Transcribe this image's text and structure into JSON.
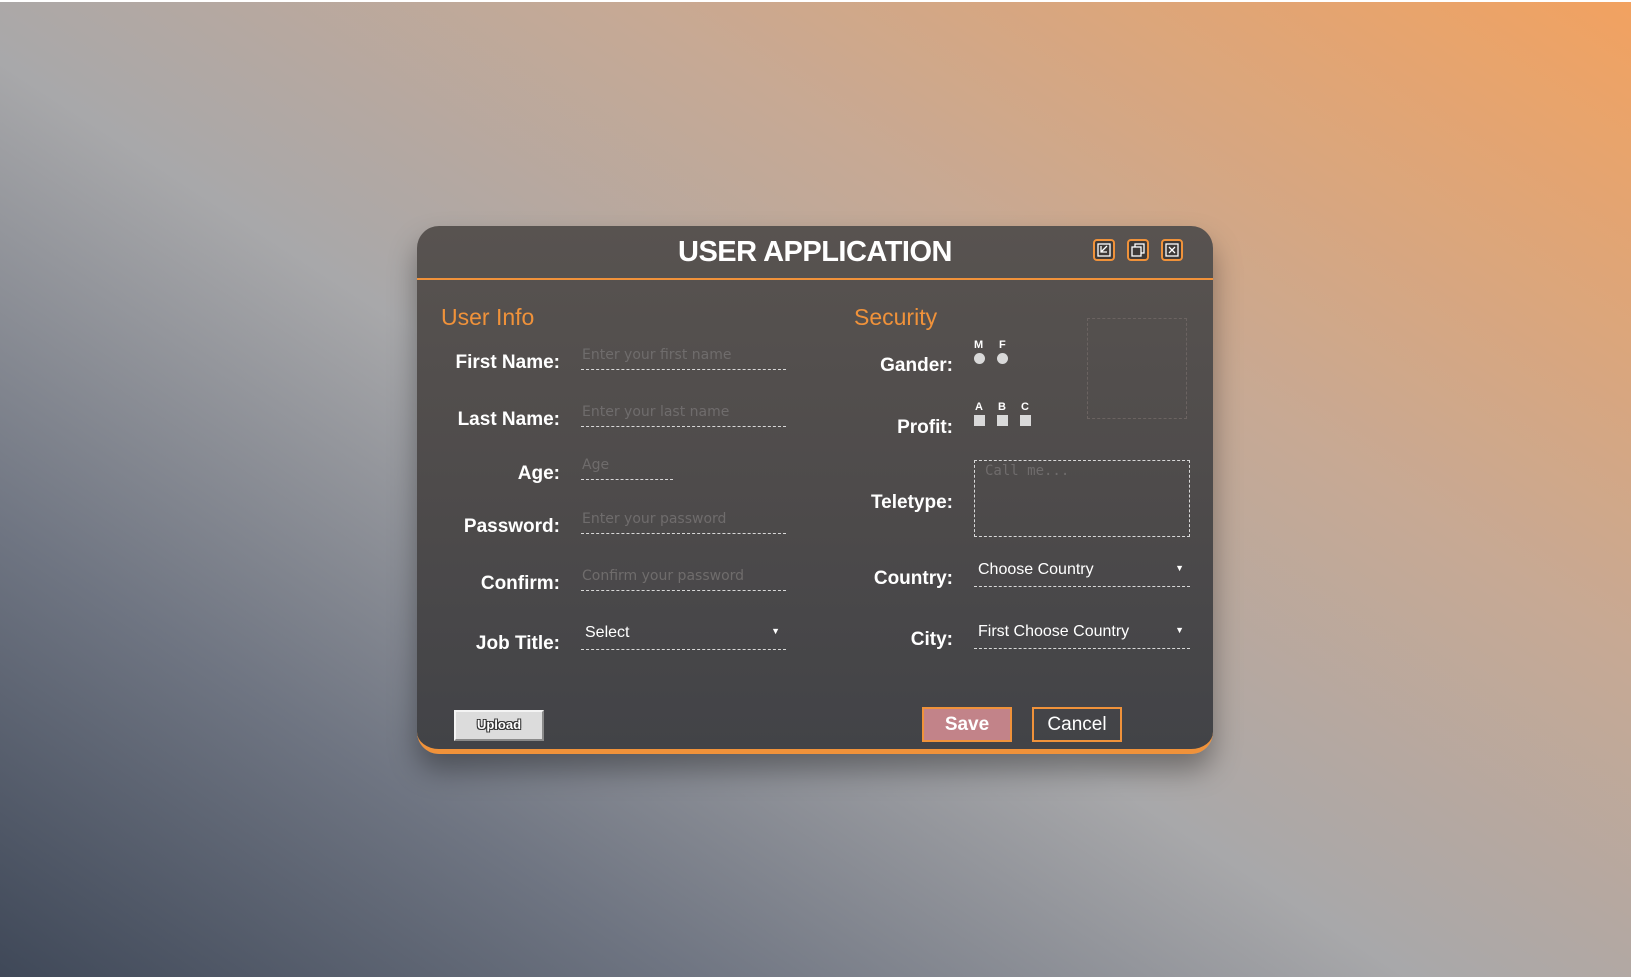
{
  "window": {
    "title": "USER APPLICATION",
    "buttons": [
      "minimize-icon",
      "restore-icon",
      "close-icon"
    ],
    "accent": "#f0923a"
  },
  "user_info": {
    "heading": "User Info",
    "first_name": {
      "label": "First Name:",
      "placeholder": "Enter your first name",
      "value": ""
    },
    "last_name": {
      "label": "Last Name:",
      "placeholder": "Enter your last name",
      "value": ""
    },
    "age": {
      "label": "Age:",
      "placeholder": "Age",
      "value": ""
    },
    "password": {
      "label": "Password:",
      "placeholder": "Enter your password",
      "value": ""
    },
    "confirm": {
      "label": "Confirm:",
      "placeholder": "Confirm your password",
      "value": ""
    },
    "job_title": {
      "label": "Job Title:",
      "selected": "Select"
    }
  },
  "security": {
    "heading": "Security",
    "gender": {
      "label": "Gander:",
      "options": [
        "M",
        "F"
      ]
    },
    "profit": {
      "label": "Profit:",
      "options": [
        "A",
        "B",
        "C"
      ]
    },
    "teletype": {
      "label": "Teletype:",
      "placeholder": "Call me..."
    },
    "country": {
      "label": "Country:",
      "selected": "Choose Country"
    },
    "city": {
      "label": "City:",
      "selected": "First Choose Country"
    }
  },
  "actions": {
    "upload": "Upload",
    "save": "Save",
    "cancel": "Cancel"
  }
}
